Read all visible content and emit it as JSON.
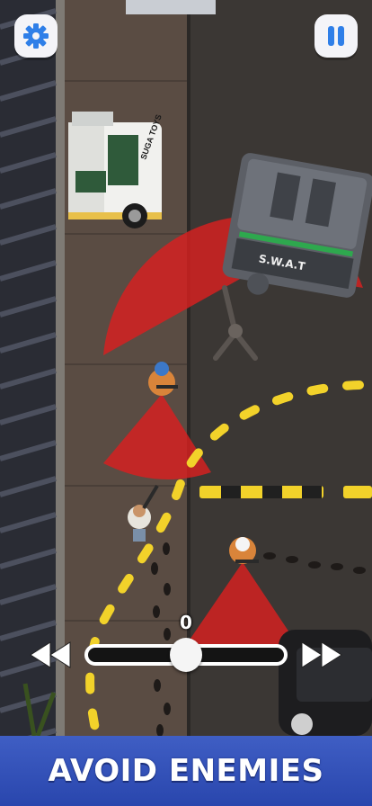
{
  "hud": {
    "settings_icon": "gear-icon",
    "pause_icon": "pause-icon",
    "accent": "#2f7fe8"
  },
  "scene": {
    "van_label": "S.W.A.T",
    "truck_label": "SUGA TOYS",
    "cone_color": "#d92020",
    "path_color": "#f2d22a"
  },
  "timeline": {
    "counter": "0",
    "rewind_icon": "rewind-icon",
    "forward_icon": "fast-forward-icon",
    "progress": 0.5
  },
  "banner": {
    "text": "AVOID ENEMIES",
    "color": "#3552b8"
  }
}
